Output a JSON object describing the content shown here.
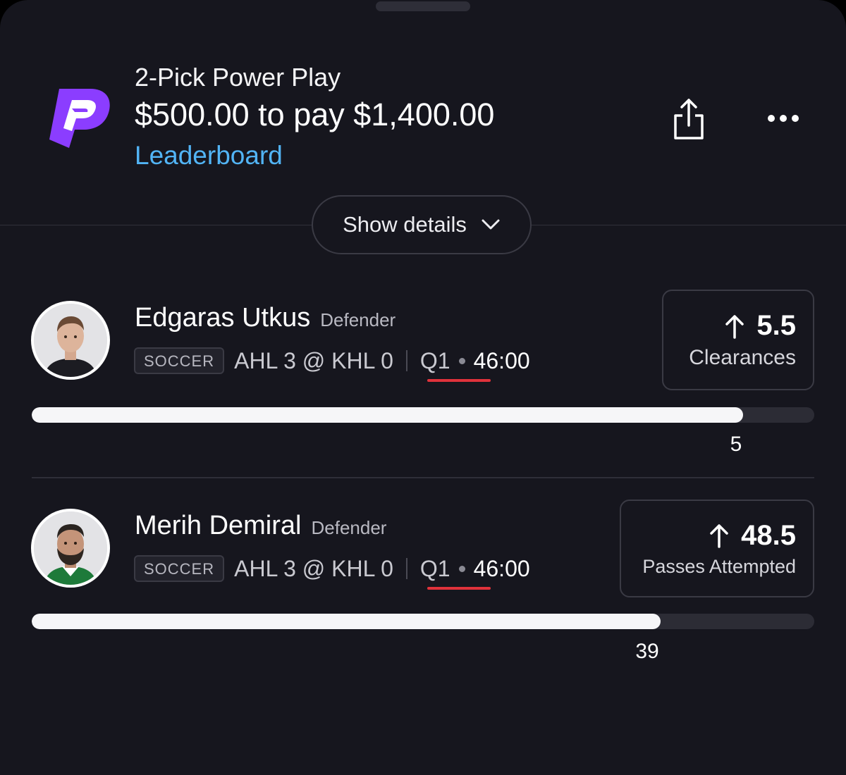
{
  "header": {
    "entry_type": "2-Pick Power Play",
    "payout": "$500.00 to pay $1,400.00",
    "leaderboard_label": "Leaderboard",
    "brand_color": "#8b3dff"
  },
  "details_button": {
    "label": "Show details"
  },
  "picks": [
    {
      "player_name": "Edgaras Utkus",
      "position": "Defender",
      "sport": "SOCCER",
      "score": "AHL 3 @ KHL 0",
      "period": "Q1",
      "clock": "46:00",
      "line_direction": "up",
      "line_value": "5.5",
      "stat": "Clearances",
      "current": "5",
      "progress_fraction": 0.909
    },
    {
      "player_name": "Merih Demiral",
      "position": "Defender",
      "sport": "SOCCER",
      "score": "AHL 3 @ KHL 0",
      "period": "Q1",
      "clock": "46:00",
      "line_direction": "up",
      "line_value": "48.5",
      "stat": "Passes Attempted",
      "current": "39",
      "progress_fraction": 0.804
    }
  ],
  "colors": {
    "background": "#16161e",
    "link": "#52b4f5",
    "live_indicator": "#e0323b"
  }
}
